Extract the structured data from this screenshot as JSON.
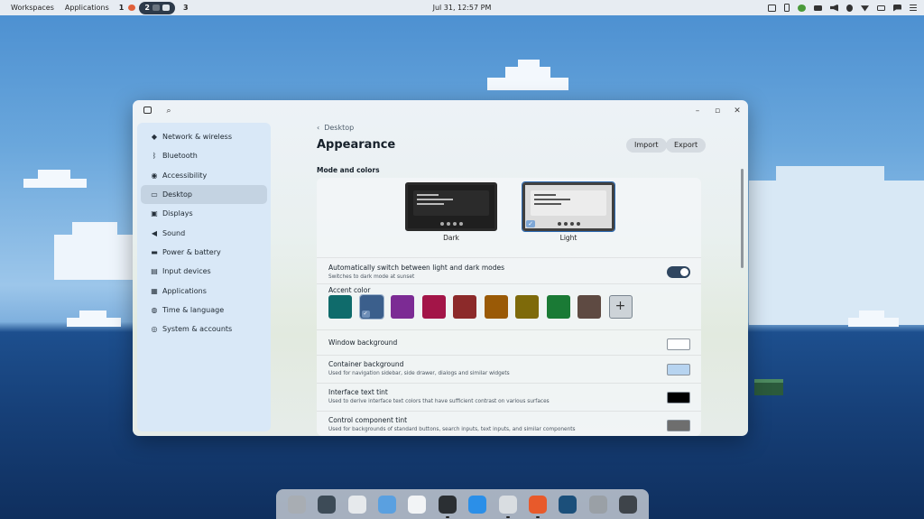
{
  "topbar": {
    "workspaces_label": "Workspaces",
    "applications_label": "Applications",
    "workspace_1": "1",
    "workspace_2": "2",
    "workspace_3": "3",
    "clock": "Jul 31, 12:57 PM",
    "tray_icons": [
      "window-icon",
      "phone-icon",
      "pin-icon",
      "battery-icon",
      "volume-icon",
      "bluetooth-icon",
      "wifi-icon",
      "power-icon",
      "notification-icon",
      "menu-icon"
    ]
  },
  "window": {
    "controls": {
      "minimize": "–",
      "maximize": "▫",
      "close": "✕"
    },
    "sidebar": {
      "items": [
        {
          "label": "Network & wireless",
          "icon": "wifi-icon",
          "glyph": "◆"
        },
        {
          "label": "Bluetooth",
          "icon": "bluetooth-icon",
          "glyph": "ᛒ"
        },
        {
          "label": "Accessibility",
          "icon": "accessibility-icon",
          "glyph": "◉"
        },
        {
          "label": "Desktop",
          "icon": "monitor-icon",
          "glyph": "▭",
          "active": true
        },
        {
          "label": "Displays",
          "icon": "displays-icon",
          "glyph": "▣"
        },
        {
          "label": "Sound",
          "icon": "speaker-icon",
          "glyph": "◀"
        },
        {
          "label": "Power & battery",
          "icon": "battery-icon",
          "glyph": "▬"
        },
        {
          "label": "Input devices",
          "icon": "keyboard-icon",
          "glyph": "▤"
        },
        {
          "label": "Applications",
          "icon": "apps-grid-icon",
          "glyph": "▦"
        },
        {
          "label": "Time & language",
          "icon": "globe-icon",
          "glyph": "◍"
        },
        {
          "label": "System & accounts",
          "icon": "system-icon",
          "glyph": "◎"
        }
      ]
    },
    "breadcrumb": "Desktop",
    "title": "Appearance",
    "import_label": "Import",
    "export_label": "Export",
    "section_title": "Mode and colors",
    "modes": {
      "dark": "Dark",
      "light": "Light",
      "selected": "Light"
    },
    "auto_switch": {
      "title": "Automatically switch between light and dark modes",
      "subtitle": "Switches to dark mode at sunset",
      "enabled": true
    },
    "accent": {
      "title": "Accent color",
      "colors": [
        "#0f6b6b",
        "#3b5f8c",
        "#7c2b94",
        "#a31548",
        "#8c2a2a",
        "#9a5a06",
        "#7e6a0a",
        "#1a7a35",
        "#5e4a42"
      ],
      "selected_index": 1
    },
    "window_background": {
      "title": "Window background",
      "color": "#ffffff"
    },
    "container_background": {
      "title": "Container background",
      "subtitle": "Used for navigation sidebar, side drawer, dialogs and similar widgets",
      "color": "#b7d4f0"
    },
    "interface_text_tint": {
      "title": "Interface text tint",
      "subtitle": "Used to derive interface text colors that have sufficient contrast on various surfaces",
      "color": "#000000"
    },
    "control_component_tint": {
      "title": "Control component tint",
      "subtitle": "Used for backgrounds of standard buttons, search inputs, text inputs, and similar components",
      "color": "#6e6e6e"
    }
  },
  "dock": {
    "apps": [
      {
        "name": "launcher-app",
        "color": "#a8adb3",
        "running": false
      },
      {
        "name": "workspaces-app",
        "color": "#3d4b57",
        "running": false
      },
      {
        "name": "app-grid-app",
        "color": "#e6e9ec",
        "running": false
      },
      {
        "name": "files-app",
        "color": "#5aa0e0",
        "running": false
      },
      {
        "name": "text-editor-app",
        "color": "#f2f4f6",
        "running": false
      },
      {
        "name": "terminal-app",
        "color": "#2b2f33",
        "running": true
      },
      {
        "name": "store-app",
        "color": "#2b8fe8",
        "running": false
      },
      {
        "name": "settings-app",
        "color": "#d9dde1",
        "running": true
      },
      {
        "name": "brave-browser-app",
        "color": "#e85a2b",
        "running": true
      },
      {
        "name": "steam-app",
        "color": "#1b4f7a",
        "running": false
      },
      {
        "name": "screenshot-app",
        "color": "#9aa0a6",
        "running": false
      },
      {
        "name": "system-monitor-app",
        "color": "#3e444a",
        "running": false
      }
    ]
  }
}
